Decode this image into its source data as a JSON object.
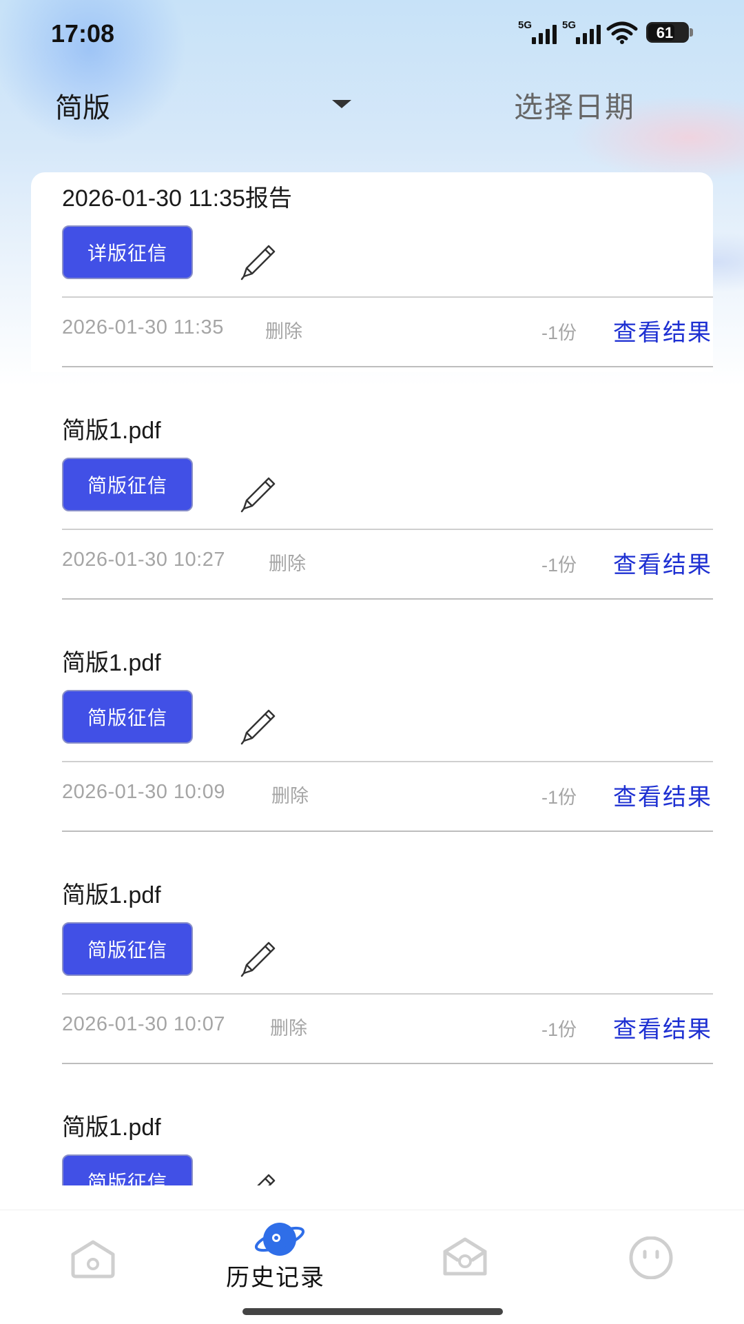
{
  "status_bar": {
    "time": "17:08",
    "signal1": "5G",
    "signal2": "5G",
    "battery": "61"
  },
  "header": {
    "filter_label": "简版",
    "date_select": "选择日期"
  },
  "records": [
    {
      "title": "2026-01-30 11:35报告",
      "tag": "详版征信",
      "date": "2026-01-30 11:35",
      "delete": "删除",
      "count": "-1份",
      "view": "查看结果"
    },
    {
      "title": "简版1.pdf",
      "tag": "简版征信",
      "date": "2026-01-30 10:27",
      "delete": "删除",
      "count": "-1份",
      "view": "查看结果"
    },
    {
      "title": "简版1.pdf",
      "tag": "简版征信",
      "date": "2026-01-30 10:09",
      "delete": "删除",
      "count": "-1份",
      "view": "查看结果"
    },
    {
      "title": "简版1.pdf",
      "tag": "简版征信",
      "date": "2026-01-30 10:07",
      "delete": "删除",
      "count": "-1份",
      "view": "查看结果"
    },
    {
      "title": "简版1.pdf",
      "tag": "简版征信"
    }
  ],
  "tabbar": {
    "active_label": "历史记录",
    "icons": [
      "home-icon",
      "planet-icon",
      "inbox-icon",
      "smiley-face-icon"
    ]
  },
  "colors": {
    "accent": "#4150e6",
    "link": "#1e30d2"
  }
}
